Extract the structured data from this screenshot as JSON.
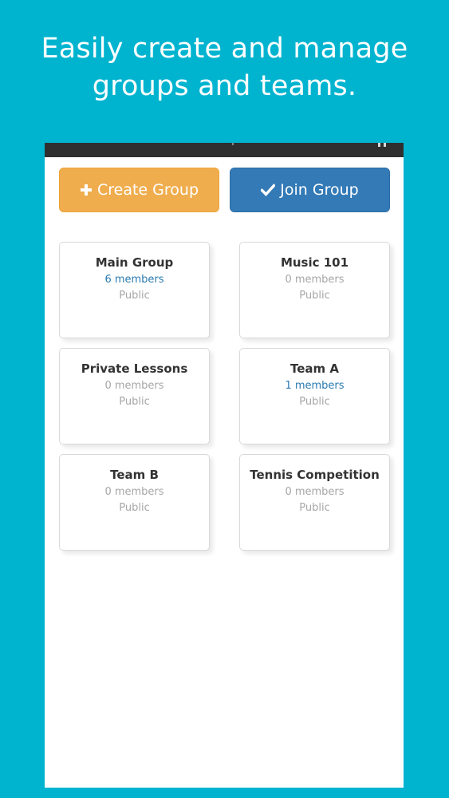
{
  "headline": {
    "line1": "Easily create and manage",
    "line2": "groups and teams."
  },
  "colors": {
    "background": "#00b4d0",
    "create_button": "#f0ad4e",
    "join_button": "#337ab7",
    "members_highlight": "#2a7ab0"
  },
  "actions": {
    "create_label": "Create Group",
    "create_icon": "plus-icon",
    "join_label": "Join Group",
    "join_icon": "checkmark-icon"
  },
  "groups": [
    {
      "name": "Main Group",
      "members": "6 members",
      "visibility": "Public"
    },
    {
      "name": "Music 101",
      "members": "0 members",
      "visibility": "Public"
    },
    {
      "name": "Private Lessons",
      "members": "0 members",
      "visibility": "Public"
    },
    {
      "name": "Team A",
      "members": "1 members",
      "visibility": "Public"
    },
    {
      "name": "Team B",
      "members": "0 members",
      "visibility": "Public"
    },
    {
      "name": "Tennis Competition",
      "members": "0 members",
      "visibility": "Public"
    }
  ]
}
